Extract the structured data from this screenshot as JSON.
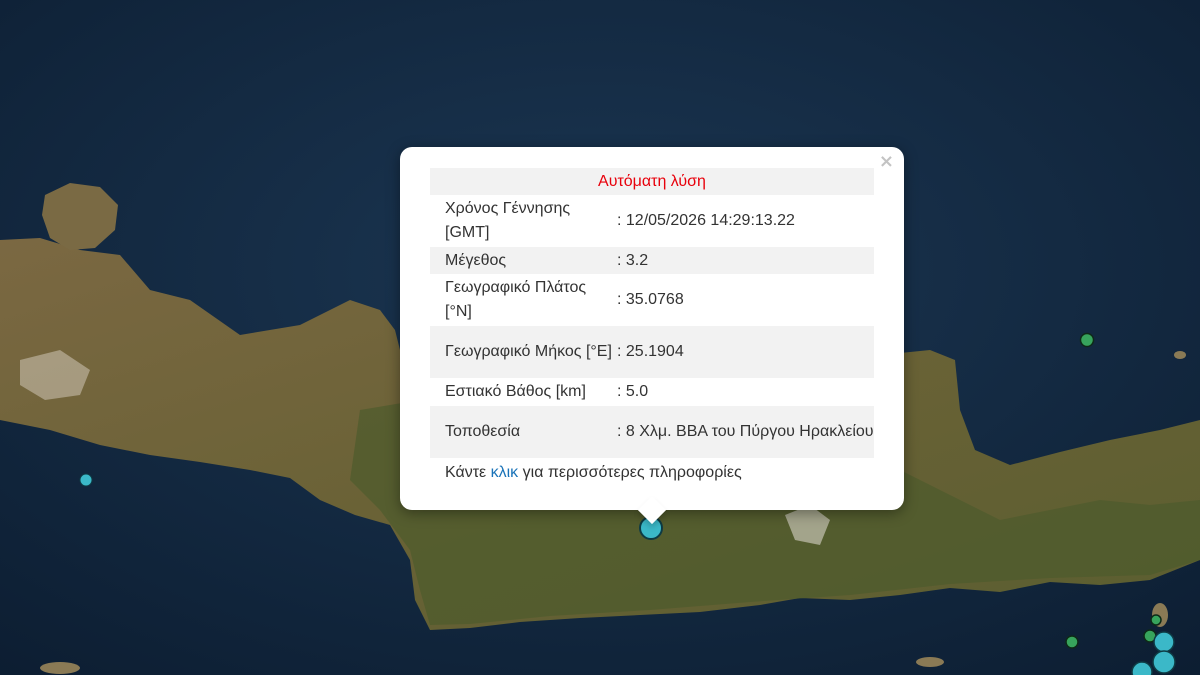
{
  "map": {
    "colors": {
      "sea": "#0f2238",
      "land": "#6b5b3a",
      "vegetation": "#4a5a2e",
      "marker_large": "#3bb8c8",
      "marker_small": "#37a45c"
    }
  },
  "popup": {
    "close_label": "×",
    "title": "Αυτόματη λύση",
    "rows": [
      {
        "label": "Χρόνος Γέννησης [GMT]",
        "value": ": 12/05/2026 14:29:13.22"
      },
      {
        "label": "Μέγεθος",
        "value": ": 3.2"
      },
      {
        "label": "Γεωγραφικό Πλάτος [°N]",
        "value": ": 35.0768"
      },
      {
        "label": "Γεωγραφικό Μήκος [°E]",
        "value": ": 25.1904"
      },
      {
        "label": "Εστιακό Βάθος [km]",
        "value": ": 5.0"
      },
      {
        "label": "Τοποθεσία",
        "value": ": 8 Χλμ. ΒΒΑ του Πύργου Ηρακλείου"
      }
    ],
    "more_prefix": "Κάντε ",
    "more_link": "κλικ",
    "more_suffix": " για περισσότερες πληροφορίες"
  }
}
